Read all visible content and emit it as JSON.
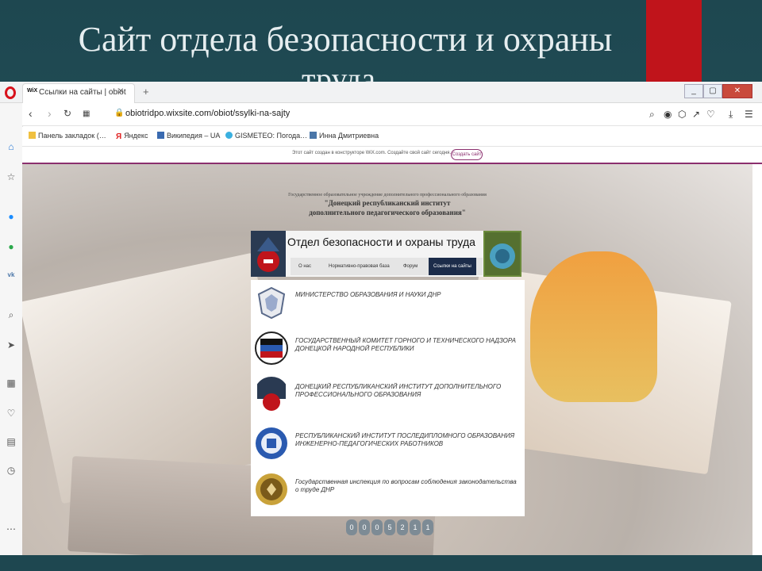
{
  "slide": {
    "title_line1": "Сайт отдела безопасности и охраны",
    "title_line2": "труда",
    "accent_color": "#c0141b"
  },
  "browser": {
    "tab_title": "Ссылки на сайты | obiot",
    "tab_favicon": "WiX",
    "url": "obiotridpo.wixsite.com/obiot/ssylki-na-sajty",
    "window_buttons": [
      "_",
      "▢",
      "✕"
    ],
    "bookmarks": [
      {
        "label": "Панель закладок (…",
        "icon": "folder-icon"
      },
      {
        "label": "Яндекс",
        "icon": "yandex-icon"
      },
      {
        "label": "Википедия – UA",
        "icon": "wikipedia-icon"
      },
      {
        "label": "GISMETEO: Погода…",
        "icon": "gismeteo-icon"
      },
      {
        "label": "Инна Дмитриевна",
        "icon": "vk-icon"
      }
    ]
  },
  "wix_banner": {
    "text": "Этот сайт создан в конструкторе WiX.com. Создайте свой сайт сегодня.",
    "button": "Создать сайт"
  },
  "site": {
    "header_line1": "Государственное образовательное учреждение дополнительного профессионального образования",
    "header_line2": "\"Донецкий республиканский институт",
    "header_line3": "дополнительного педагогического образования\"",
    "title": "Отдел безопасности и охраны труда",
    "menu": [
      "О нас",
      "Нормативно-правовая база",
      "Форум",
      "Ссылки на сайты"
    ],
    "active_menu": "Ссылки на сайты",
    "organizations": [
      {
        "name": "МИНИСТЕРСТВО ОБРАЗОВАНИЯ И НАУКИ ДНР",
        "logo": "coat-of-arms-icon"
      },
      {
        "name": "ГОСУДАРСТВЕННЫЙ КОМИТЕТ ГОРНОГО И ТЕХНИЧЕСКОГО НАДЗОРА ДОНЕЦКОЙ НАРОДНОЙ РЕСПУБЛИКИ",
        "logo": "flag-emblem-icon"
      },
      {
        "name": "ДОНЕЦКИЙ РЕСПУБЛИКАНСКИЙ ИНСТИТУТ ДОПОЛНИТЕЛЬНОГО ПРОФЕССИОНАЛЬНОГО ОБРАЗОВАНИЯ",
        "logo": "institute-emblem-icon"
      },
      {
        "name": "РЕСПУБЛИКАНСКИЙ ИНСТИТУТ ПОСЛЕДИПЛОМНОГО ОБРАЗОВАНИЯ ИНЖЕНЕРНО-ПЕДАГОГИЧЕСКИХ РАБОТНИКОВ",
        "logo": "round-seal-icon"
      },
      {
        "name": "Государственная инспекция по вопросам соблюдения законодательства о труде ДНР",
        "logo": "inspection-emblem-icon"
      }
    ],
    "pager": [
      "0",
      "0",
      "0",
      "5",
      "2",
      "1",
      "1"
    ]
  }
}
